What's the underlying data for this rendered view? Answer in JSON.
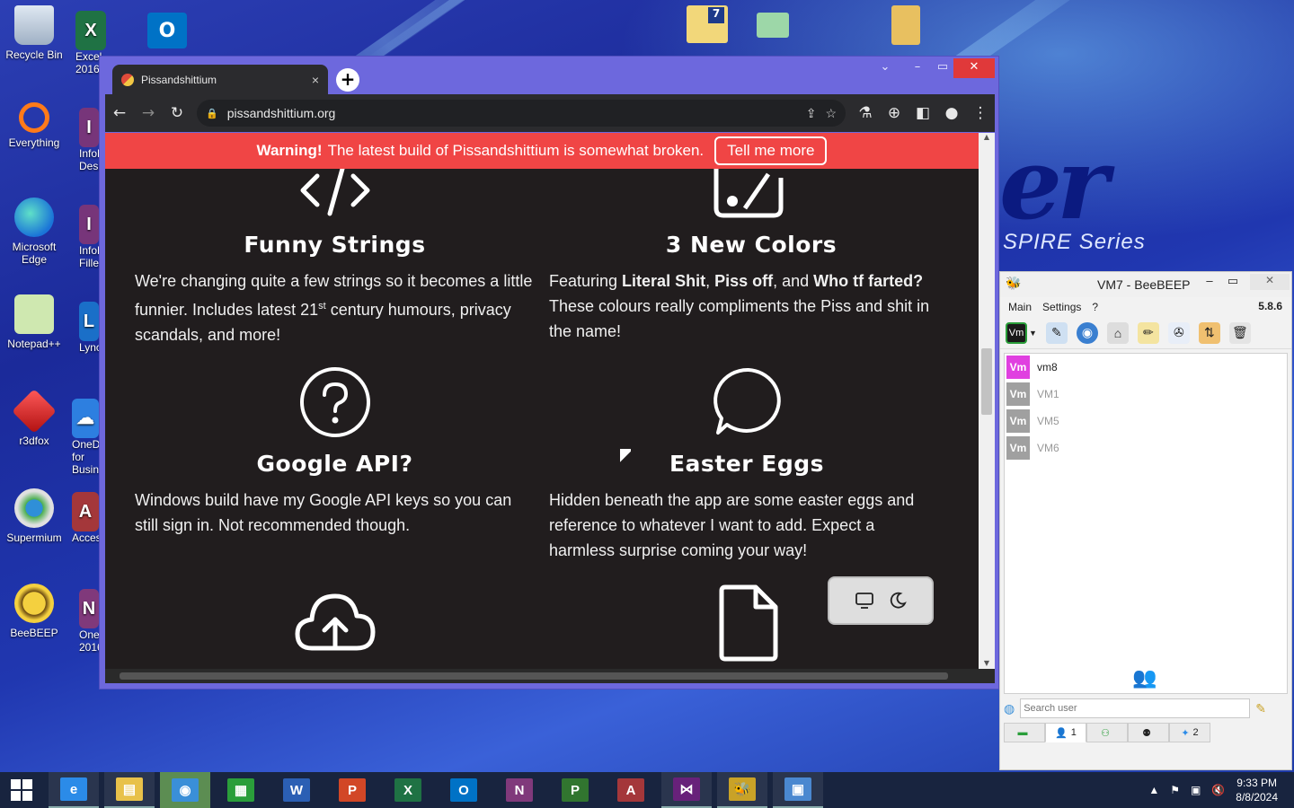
{
  "desktop": {
    "icons_left": [
      {
        "label": "Recycle Bin",
        "icon": "recycle-bin-icon"
      },
      {
        "label": "Everything",
        "icon": "everything-search-icon"
      },
      {
        "label": "Microsoft Edge",
        "icon": "edge-icon"
      },
      {
        "label": "Notepad++",
        "icon": "notepadpp-icon"
      },
      {
        "label": "r3dfox",
        "icon": "r3dfox-icon"
      },
      {
        "label": "Supermium",
        "icon": "supermium-icon"
      },
      {
        "label": "BeeBEEP",
        "icon": "beebeep-icon"
      }
    ],
    "icons_col2": [
      {
        "label": "Excel 2016",
        "glyph": "X"
      },
      {
        "label": "InfoPath Designer",
        "glyph": "I"
      },
      {
        "label": "InfoPath Filler",
        "glyph": "I"
      },
      {
        "label": "Lync",
        "glyph": "L"
      },
      {
        "label": "OneDrive for Business",
        "glyph": "☁"
      },
      {
        "label": "Access",
        "glyph": "A"
      },
      {
        "label": "OneNote 2016",
        "glyph": "N"
      }
    ],
    "wallpaper_text": {
      "brand_fragment": "er",
      "series": "SPIRE Series"
    }
  },
  "browser": {
    "tab_title": "Pissandshittium",
    "tab_close": "×",
    "new_tab": "+",
    "url": "pissandshittium.org",
    "window_controls": {
      "dropdown": "⌄",
      "minimize": "–",
      "maximize": "▭",
      "close": "✕"
    },
    "banner": {
      "bold": "Warning!",
      "text": "The latest build of Pissandshittium is somewhat broken.",
      "button": "Tell me more",
      "color": "#f04545"
    },
    "features": [
      {
        "title": "Funny Strings",
        "icon": "code-icon",
        "body_a": "We're changing quite a few strings so it becomes a little funnier. Includes latest 21",
        "sup": "st",
        "body_b": " century humours, privacy scandals, and more!"
      },
      {
        "title": "3 New Colors",
        "icon": "palette-icon",
        "pre": "Featuring ",
        "b1": "Literal Shit",
        "sep1": ", ",
        "b2": "Piss off",
        "sep2": ", and ",
        "b3": "Who tf farted?",
        "post": " These colours really compliments the Piss and shit in the name!"
      },
      {
        "title": "Google API?",
        "icon": "question-icon",
        "body": "Windows build have my Google API keys so you can still sign in. Not recommended though."
      },
      {
        "title": "Easter Eggs",
        "icon": "speech-bubble-icon",
        "body": "Hidden beneath the app are some easter eggs and reference to whatever I want to add. Expect a harmless surprise coming your way!"
      },
      {
        "icon": "cloud-upload-icon"
      },
      {
        "icon": "file-icon"
      }
    ],
    "theme_toggle": {
      "left": "monitor-icon",
      "right": "moon-icon"
    }
  },
  "beebeep": {
    "title": "VM7 - BeeBEEP",
    "menu": [
      "Main",
      "Settings",
      "?"
    ],
    "version": "5.8.6",
    "users": [
      {
        "name": "vm8",
        "badge": "Vm",
        "online": true
      },
      {
        "name": "VM1",
        "badge": "Vm",
        "online": false
      },
      {
        "name": "VM5",
        "badge": "Vm",
        "online": false
      },
      {
        "name": "VM6",
        "badge": "Vm",
        "online": false
      }
    ],
    "search_placeholder": "Search user",
    "tabs": [
      {
        "icon": "chat-icon",
        "count": ""
      },
      {
        "icon": "users-icon",
        "count": "1"
      },
      {
        "icon": "group-icon",
        "count": ""
      },
      {
        "icon": "people-icon",
        "count": ""
      },
      {
        "icon": "pin-icon",
        "count": "2"
      }
    ],
    "colors": {
      "online": "#e040e0",
      "offline": "#a0a0a0"
    }
  },
  "taskbar": {
    "apps": [
      {
        "name": "internet-explorer",
        "glyph": "e",
        "color": "#2b8be8"
      },
      {
        "name": "file-explorer",
        "glyph": "▤",
        "color": "#e8c14a"
      },
      {
        "name": "supermium",
        "glyph": "◉",
        "color": "#3a8fd8"
      },
      {
        "name": "project-store",
        "glyph": "▦",
        "color": "#2a9e3a"
      },
      {
        "name": "word",
        "glyph": "W",
        "color": "#2b5fb4"
      },
      {
        "name": "powerpoint",
        "glyph": "P",
        "color": "#d24726"
      },
      {
        "name": "excel",
        "glyph": "X",
        "color": "#1f7244"
      },
      {
        "name": "outlook",
        "glyph": "O",
        "color": "#0072c6"
      },
      {
        "name": "onenote",
        "glyph": "N",
        "color": "#80397b"
      },
      {
        "name": "project",
        "glyph": "P",
        "color": "#31752f"
      },
      {
        "name": "access",
        "glyph": "A",
        "color": "#a4373a"
      },
      {
        "name": "visual-studio",
        "glyph": "⋈",
        "color": "#68217a"
      },
      {
        "name": "beebeep",
        "glyph": "🐝",
        "color": "#c9a227"
      },
      {
        "name": "control-panel",
        "glyph": "▣",
        "color": "#4a88d0"
      }
    ],
    "clock": {
      "time": "9:33 PM",
      "date": "8/8/2024"
    }
  }
}
